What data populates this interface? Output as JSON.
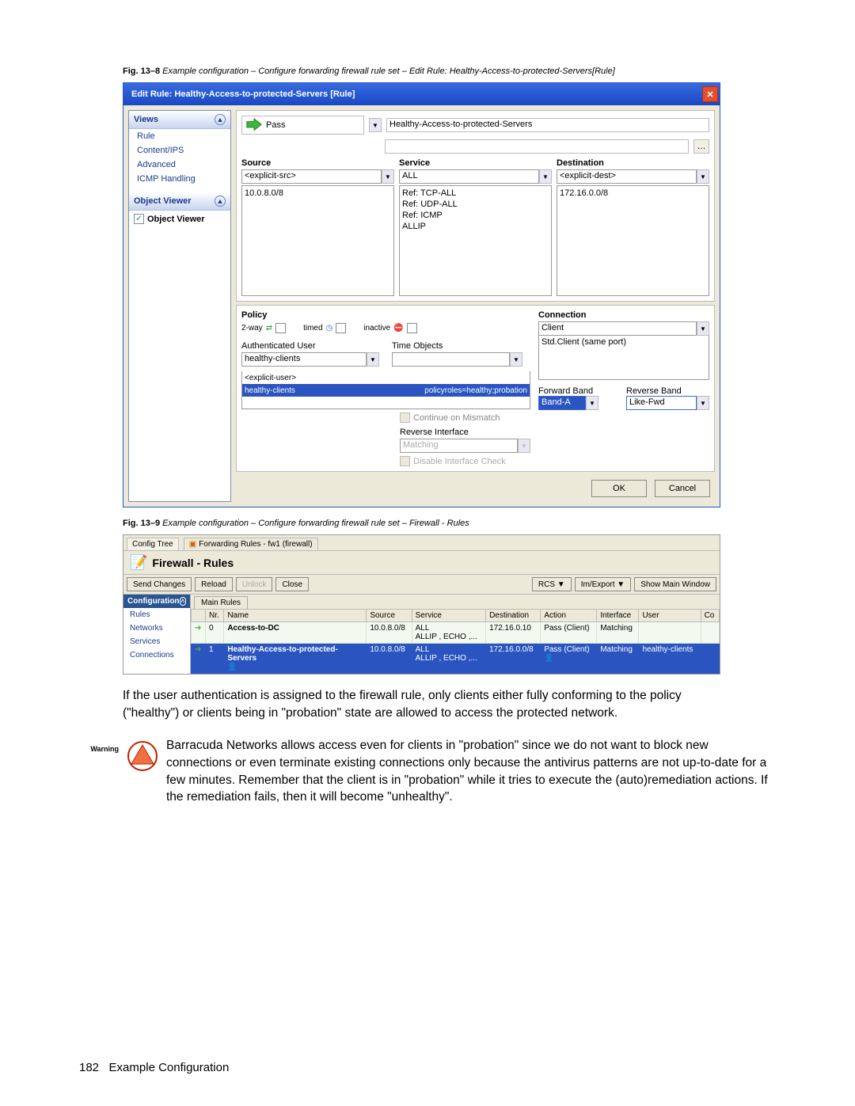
{
  "caption1": {
    "prefix": "Fig. 13–8",
    "text": "Example configuration – Configure forwarding firewall rule set – Edit Rule: Healthy-Access-to-protected-Servers[Rule]"
  },
  "caption2": {
    "prefix": "Fig. 13–9",
    "text": "Example configuration – Configure forwarding firewall rule set – Firewall - Rules"
  },
  "dialog": {
    "title": "Edit Rule: Healthy-Access-to-protected-Servers [Rule]",
    "views_head": "Views",
    "views": [
      "Rule",
      "Content/IPS",
      "Advanced",
      "ICMP Handling"
    ],
    "objview_head": "Object Viewer",
    "objview_check": "Object Viewer",
    "action": "Pass",
    "rule_name": "Healthy-Access-to-protected-Servers",
    "source_head": "Source",
    "service_head": "Service",
    "dest_head": "Destination",
    "source_sel": "<explicit-src>",
    "service_sel": "ALL",
    "dest_sel": "<explicit-dest>",
    "source_items": [
      "10.0.8.0/8"
    ],
    "service_items": [
      "Ref: TCP-ALL",
      "Ref: UDP-ALL",
      "Ref: ICMP",
      "ALLIP"
    ],
    "dest_items": [
      "172.16.0.0/8"
    ],
    "policy_head": "Policy",
    "pol_2way": "2-way",
    "pol_timed": "timed",
    "pol_inactive": "inactive",
    "authuser_head": "Authenticated User",
    "authuser_sel": "healthy-clients",
    "authuser_rows": [
      {
        "left": "<explicit-user>",
        "right": "",
        "sel": false
      },
      {
        "left": "healthy-clients",
        "right": "policyroles=healthy;probation",
        "sel": true
      }
    ],
    "time_head": "Time Objects",
    "continue_check": "Continue on Mismatch",
    "revif_head": "Reverse Interface",
    "revif_val": "Matching",
    "disable_if": "Disable Interface Check",
    "conn_head": "Connection",
    "conn_sel": "Client",
    "conn_items": [
      "Std.Client (same port)"
    ],
    "fwd_band_head": "Forward Band",
    "rev_band_head": "Reverse Band",
    "fwd_band": "Band-A",
    "rev_band": "Like-Fwd",
    "ok": "OK",
    "cancel": "Cancel"
  },
  "fw": {
    "tab1": "Config Tree",
    "tab2": "Forwarding Rules - fw1 (firewall)",
    "title": "Firewall - Rules",
    "btns": {
      "send": "Send Changes",
      "reload": "Reload",
      "unlock": "Unlock",
      "close": "Close",
      "rcs": "RCS",
      "ie": "Im/Export",
      "main": "Show Main Window"
    },
    "side_head": "Configuration",
    "side_items": [
      "Rules",
      "Networks",
      "Services",
      "Connections"
    ],
    "mtab": "Main Rules",
    "cols": [
      "Nr.",
      "Name",
      "Source",
      "Service",
      "Destination",
      "Action",
      "Interface",
      "User",
      "Co"
    ],
    "rows": [
      {
        "nr": "0",
        "name": "Access-to-DC",
        "src": "10.0.8.0/8",
        "svc": "ALL\nALLIP , ECHO ,...",
        "dst": "172.16.0.10",
        "act": "Pass (Client)",
        "if": "Matching",
        "user": "",
        "sel": false
      },
      {
        "nr": "1",
        "name": "Healthy-Access-to-protected-Servers",
        "src": "10.0.8.0/8",
        "svc": "ALL\nALLIP , ECHO ,...",
        "dst": "172.16.0.0/8",
        "act": "Pass (Client)",
        "if": "Matching",
        "user": "healthy-clients",
        "sel": true
      }
    ]
  },
  "body_para": "If the user authentication is assigned to the firewall rule, only clients either fully conforming to the policy (\"healthy\") or clients being in \"probation\" state are allowed to access the protected network.",
  "warning_label": "Warning",
  "warning_text": "Barracuda Networks allows access even for clients in \"probation\" since we do not want to block new connections or even terminate existing connections only because the antivirus patterns are not up-to-date for a few minutes. Remember that the client is in \"probation\" while it tries to execute the (auto)remediation actions. If the remediation fails, then it will become \"unhealthy\".",
  "footer": {
    "page": "182",
    "title": "Example Configuration"
  }
}
